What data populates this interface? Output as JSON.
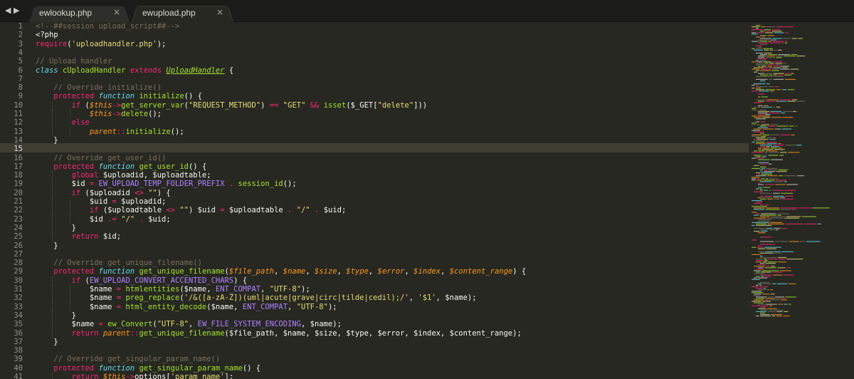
{
  "tabs": [
    {
      "label": "ewlookup.php",
      "active": false
    },
    {
      "label": "ewupload.php",
      "active": true
    }
  ],
  "nav": {
    "back_icon": "◀",
    "forward_icon": "▶"
  },
  "close_icon": "×",
  "editor": {
    "current_line": 15,
    "lines": [
      {
        "n": 1,
        "tokens": [
          [
            "c",
            "<!--##session upload_script##-->"
          ]
        ]
      },
      {
        "n": 2,
        "tokens": [
          [
            "p",
            "<?php"
          ]
        ]
      },
      {
        "n": 3,
        "tokens": [
          [
            "k",
            "require"
          ],
          [
            "p",
            "("
          ],
          [
            "s",
            "'uploadhandler.php'"
          ],
          [
            "p",
            ");"
          ]
        ]
      },
      {
        "n": 4,
        "tokens": []
      },
      {
        "n": 5,
        "tokens": [
          [
            "c",
            "// Upload handler"
          ]
        ]
      },
      {
        "n": 6,
        "tokens": [
          [
            "st",
            "class"
          ],
          [
            "p",
            " "
          ],
          [
            "f",
            "cUploadHandler"
          ],
          [
            "p",
            " "
          ],
          [
            "k",
            "extends"
          ],
          [
            "p",
            " "
          ],
          [
            "i",
            "UploadHandler"
          ],
          [
            "p",
            " {"
          ]
        ]
      },
      {
        "n": 7,
        "tokens": []
      },
      {
        "n": 8,
        "tokens": [
          [
            "p",
            "    "
          ],
          [
            "c",
            "// Override initialize()"
          ]
        ]
      },
      {
        "n": 9,
        "tokens": [
          [
            "p",
            "    "
          ],
          [
            "k",
            "protected"
          ],
          [
            "p",
            " "
          ],
          [
            "st",
            "function"
          ],
          [
            "p",
            " "
          ],
          [
            "f",
            "initialize"
          ],
          [
            "p",
            "() {"
          ]
        ]
      },
      {
        "n": 10,
        "tokens": [
          [
            "p",
            "        "
          ],
          [
            "k",
            "if"
          ],
          [
            "p",
            " ("
          ],
          [
            "v",
            "$this"
          ],
          [
            "k",
            "->"
          ],
          [
            "f",
            "get_server_var"
          ],
          [
            "p",
            "("
          ],
          [
            "s",
            "\"REQUEST_METHOD\""
          ],
          [
            "p",
            ") "
          ],
          [
            "k",
            "=="
          ],
          [
            "p",
            " "
          ],
          [
            "s",
            "\"GET\""
          ],
          [
            "p",
            " "
          ],
          [
            "k",
            "&&"
          ],
          [
            "p",
            " "
          ],
          [
            "f",
            "isset"
          ],
          [
            "p",
            "($_GET["
          ],
          [
            "s",
            "\"delete\""
          ],
          [
            "p",
            "]))"
          ]
        ]
      },
      {
        "n": 11,
        "tokens": [
          [
            "p",
            "            "
          ],
          [
            "v",
            "$this"
          ],
          [
            "k",
            "->"
          ],
          [
            "f",
            "delete"
          ],
          [
            "p",
            "();"
          ]
        ]
      },
      {
        "n": 12,
        "tokens": [
          [
            "p",
            "        "
          ],
          [
            "k",
            "else"
          ]
        ]
      },
      {
        "n": 13,
        "tokens": [
          [
            "p",
            "            "
          ],
          [
            "v",
            "parent"
          ],
          [
            "k",
            "::"
          ],
          [
            "f",
            "initialize"
          ],
          [
            "p",
            "();"
          ]
        ]
      },
      {
        "n": 14,
        "tokens": [
          [
            "p",
            "    }"
          ]
        ]
      },
      {
        "n": 15,
        "tokens": []
      },
      {
        "n": 16,
        "tokens": [
          [
            "p",
            "    "
          ],
          [
            "c",
            "// Override get_user_id()"
          ]
        ]
      },
      {
        "n": 17,
        "tokens": [
          [
            "p",
            "    "
          ],
          [
            "k",
            "protected"
          ],
          [
            "p",
            " "
          ],
          [
            "st",
            "function"
          ],
          [
            "p",
            " "
          ],
          [
            "f",
            "get_user_id"
          ],
          [
            "p",
            "() {"
          ]
        ]
      },
      {
        "n": 18,
        "tokens": [
          [
            "p",
            "        "
          ],
          [
            "k",
            "global"
          ],
          [
            "p",
            " $uploadid, $uploadtable;"
          ]
        ]
      },
      {
        "n": 19,
        "tokens": [
          [
            "p",
            "        $id "
          ],
          [
            "k",
            "="
          ],
          [
            "p",
            " "
          ],
          [
            "n",
            "EW_UPLOAD_TEMP_FOLDER_PREFIX"
          ],
          [
            "p",
            " "
          ],
          [
            "k",
            "."
          ],
          [
            "p",
            " "
          ],
          [
            "f",
            "session_id"
          ],
          [
            "p",
            "();"
          ]
        ]
      },
      {
        "n": 20,
        "tokens": [
          [
            "p",
            "        "
          ],
          [
            "k",
            "if"
          ],
          [
            "p",
            " ($uploadid "
          ],
          [
            "k",
            "<>"
          ],
          [
            "p",
            " "
          ],
          [
            "s",
            "\"\""
          ],
          [
            "p",
            ") {"
          ]
        ]
      },
      {
        "n": 21,
        "tokens": [
          [
            "p",
            "            $uid "
          ],
          [
            "k",
            "="
          ],
          [
            "p",
            " $uploadid;"
          ]
        ]
      },
      {
        "n": 22,
        "tokens": [
          [
            "p",
            "            "
          ],
          [
            "k",
            "if"
          ],
          [
            "p",
            " ($uploadtable "
          ],
          [
            "k",
            "<>"
          ],
          [
            "p",
            " "
          ],
          [
            "s",
            "\"\""
          ],
          [
            "p",
            ") $uid "
          ],
          [
            "k",
            "="
          ],
          [
            "p",
            " $uploadtable "
          ],
          [
            "k",
            "."
          ],
          [
            "p",
            " "
          ],
          [
            "s",
            "\"/\""
          ],
          [
            "p",
            " "
          ],
          [
            "k",
            "."
          ],
          [
            "p",
            " $uid;"
          ]
        ]
      },
      {
        "n": 23,
        "tokens": [
          [
            "p",
            "            $id "
          ],
          [
            "k",
            ".="
          ],
          [
            "p",
            " "
          ],
          [
            "s",
            "\"/\""
          ],
          [
            "p",
            " "
          ],
          [
            "k",
            "."
          ],
          [
            "p",
            " $uid;"
          ]
        ]
      },
      {
        "n": 24,
        "tokens": [
          [
            "p",
            "        }"
          ]
        ]
      },
      {
        "n": 25,
        "tokens": [
          [
            "p",
            "        "
          ],
          [
            "k",
            "return"
          ],
          [
            "p",
            " $id;"
          ]
        ]
      },
      {
        "n": 26,
        "tokens": [
          [
            "p",
            "    }"
          ]
        ]
      },
      {
        "n": 27,
        "tokens": []
      },
      {
        "n": 28,
        "tokens": [
          [
            "p",
            "    "
          ],
          [
            "c",
            "// Override get_unique_filename()"
          ]
        ]
      },
      {
        "n": 29,
        "tokens": [
          [
            "p",
            "    "
          ],
          [
            "k",
            "protected"
          ],
          [
            "p",
            " "
          ],
          [
            "st",
            "function"
          ],
          [
            "p",
            " "
          ],
          [
            "f",
            "get_unique_filename"
          ],
          [
            "p",
            "("
          ],
          [
            "v",
            "$file_path"
          ],
          [
            "p",
            ", "
          ],
          [
            "v",
            "$name"
          ],
          [
            "p",
            ", "
          ],
          [
            "v",
            "$size"
          ],
          [
            "p",
            ", "
          ],
          [
            "v",
            "$type"
          ],
          [
            "p",
            ", "
          ],
          [
            "v",
            "$error"
          ],
          [
            "p",
            ", "
          ],
          [
            "v",
            "$index"
          ],
          [
            "p",
            ", "
          ],
          [
            "v",
            "$content_range"
          ],
          [
            "p",
            ") {"
          ]
        ]
      },
      {
        "n": 30,
        "tokens": [
          [
            "p",
            "        "
          ],
          [
            "k",
            "if"
          ],
          [
            "p",
            " ("
          ],
          [
            "n",
            "EW_UPLOAD_CONVERT_ACCENTED_CHARS"
          ],
          [
            "p",
            ") {"
          ]
        ]
      },
      {
        "n": 31,
        "tokens": [
          [
            "p",
            "            $name "
          ],
          [
            "k",
            "="
          ],
          [
            "p",
            " "
          ],
          [
            "f",
            "htmlentities"
          ],
          [
            "p",
            "($name, "
          ],
          [
            "n",
            "ENT_COMPAT"
          ],
          [
            "p",
            ", "
          ],
          [
            "s",
            "\"UTF-8\""
          ],
          [
            "p",
            ");"
          ]
        ]
      },
      {
        "n": 32,
        "tokens": [
          [
            "p",
            "            $name "
          ],
          [
            "k",
            "="
          ],
          [
            "p",
            " "
          ],
          [
            "f",
            "preg_replace"
          ],
          [
            "p",
            "("
          ],
          [
            "s",
            "'/&([a-zA-Z])(uml|acute|grave|circ|tilde|cedil);/'"
          ],
          [
            "p",
            ", "
          ],
          [
            "s",
            "'$1'"
          ],
          [
            "p",
            ", $name);"
          ]
        ]
      },
      {
        "n": 33,
        "tokens": [
          [
            "p",
            "            $name "
          ],
          [
            "k",
            "="
          ],
          [
            "p",
            " "
          ],
          [
            "f",
            "html_entity_decode"
          ],
          [
            "p",
            "($name, "
          ],
          [
            "n",
            "ENT_COMPAT"
          ],
          [
            "p",
            ", "
          ],
          [
            "s",
            "\"UTF-8\""
          ],
          [
            "p",
            ");"
          ]
        ]
      },
      {
        "n": 34,
        "tokens": [
          [
            "p",
            "        }"
          ]
        ]
      },
      {
        "n": 35,
        "tokens": [
          [
            "p",
            "        $name "
          ],
          [
            "k",
            "="
          ],
          [
            "p",
            " "
          ],
          [
            "f",
            "ew_Convert"
          ],
          [
            "p",
            "("
          ],
          [
            "s",
            "\"UTF-8\""
          ],
          [
            "p",
            ", "
          ],
          [
            "n",
            "EW_FILE_SYSTEM_ENCODING"
          ],
          [
            "p",
            ", $name);"
          ]
        ]
      },
      {
        "n": 36,
        "tokens": [
          [
            "p",
            "        "
          ],
          [
            "k",
            "return"
          ],
          [
            "p",
            " "
          ],
          [
            "v",
            "parent"
          ],
          [
            "k",
            "::"
          ],
          [
            "f",
            "get_unique_filename"
          ],
          [
            "p",
            "($file_path, $name, $size, $type, $error, $index, $content_range);"
          ]
        ]
      },
      {
        "n": 37,
        "tokens": [
          [
            "p",
            "    }"
          ]
        ]
      },
      {
        "n": 38,
        "tokens": []
      },
      {
        "n": 39,
        "tokens": [
          [
            "p",
            "    "
          ],
          [
            "c",
            "// Override get_singular_param_name()"
          ]
        ]
      },
      {
        "n": 40,
        "tokens": [
          [
            "p",
            "    "
          ],
          [
            "k",
            "protected"
          ],
          [
            "p",
            " "
          ],
          [
            "st",
            "function"
          ],
          [
            "p",
            " "
          ],
          [
            "f",
            "get_singular_param_name"
          ],
          [
            "p",
            "() {"
          ]
        ]
      },
      {
        "n": 41,
        "tokens": [
          [
            "p",
            "        "
          ],
          [
            "k",
            "return"
          ],
          [
            "p",
            " "
          ],
          [
            "v",
            "$this"
          ],
          [
            "k",
            "->"
          ],
          [
            "p",
            "options["
          ],
          [
            "s",
            "'param_name'"
          ],
          [
            "p",
            "];"
          ]
        ]
      }
    ]
  },
  "colors": {
    "background": "#272822",
    "comment": "#75715e",
    "keyword": "#f92672",
    "string": "#e6db74",
    "constant": "#ae81ff",
    "function": "#a6e22e",
    "storage": "#66d9ef",
    "variable": "#fd971f"
  }
}
